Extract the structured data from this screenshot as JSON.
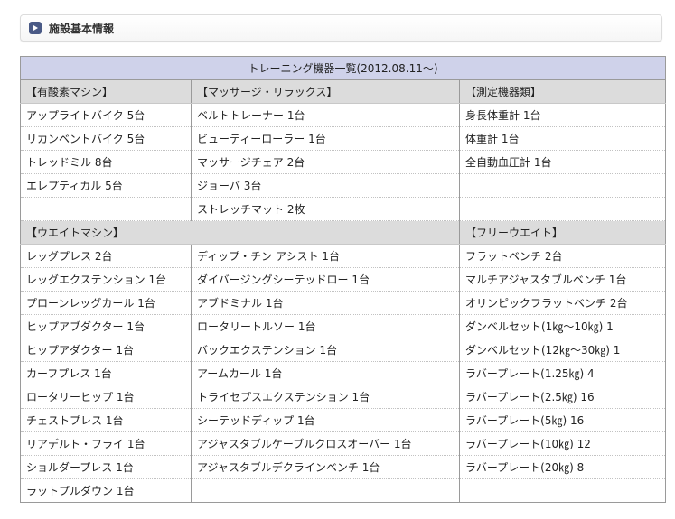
{
  "section": {
    "title": "施設基本情報",
    "icon": "play-icon",
    "icon_color": "#4a5a86"
  },
  "table": {
    "caption": "トレーニング機器一覧(2012.08.11～)",
    "caption_bg": "#cfd2ea",
    "category_bg": "#dcdcdc",
    "group1": {
      "headers": [
        "【有酸素マシン】",
        "【マッサージ・リラックス】",
        "【測定機器類】"
      ],
      "rows": [
        [
          "アップライトバイク 5台",
          "ベルトトレーナー 1台",
          "身長体重計 1台"
        ],
        [
          "リカンベントバイク 5台",
          "ビューティーローラー 1台",
          "体重計 1台"
        ],
        [
          "トレッドミル 8台",
          "マッサージチェア 2台",
          "全自動血圧計 1台"
        ],
        [
          "エレプティカル 5台",
          "ジョーバ 3台",
          ""
        ],
        [
          "",
          "ストレッチマット 2枚",
          ""
        ]
      ]
    },
    "group2": {
      "headers": [
        "【ウエイトマシン】",
        "",
        "【フリーウエイト】"
      ],
      "rows": [
        [
          "レッグプレス 2台",
          "ディップ・チン アシスト 1台",
          "フラットベンチ 2台"
        ],
        [
          "レッグエクステンション 1台",
          "ダイバージングシーテッドロー 1台",
          "マルチアジャスタブルベンチ 1台"
        ],
        [
          "プローンレッグカール 1台",
          "アブドミナル 1台",
          "オリンピックフラットベンチ 2台"
        ],
        [
          "ヒップアブダクター 1台",
          "ロータリートルソー 1台",
          "ダンベルセット(1㎏～10㎏) 1"
        ],
        [
          "ヒップアダクター 1台",
          "バックエクステンション 1台",
          "ダンベルセット(12㎏～30㎏) 1"
        ],
        [
          "カーフプレス 1台",
          "アームカール 1台",
          "ラバープレート(1.25㎏) 4"
        ],
        [
          "ロータリーヒップ 1台",
          "トライセプスエクステンション 1台",
          "ラバープレート(2.5㎏) 16"
        ],
        [
          "チェストプレス 1台",
          "シーテッドディップ 1台",
          "ラバープレート(5㎏) 16"
        ],
        [
          "リアデルト・フライ 1台",
          "アジャスタブルケーブルクロスオーバー 1台",
          "ラバープレート(10㎏) 12"
        ],
        [
          "ショルダープレス 1台",
          "アジャスタブルデクラインベンチ 1台",
          "ラバープレート(20㎏) 8"
        ],
        [
          "ラットプルダウン 1台",
          "",
          ""
        ]
      ]
    }
  }
}
